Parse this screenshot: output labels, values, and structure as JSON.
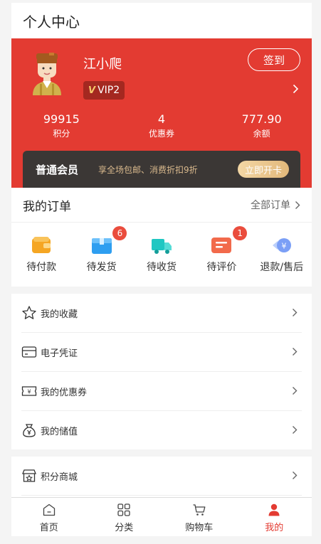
{
  "page_title": "个人中心",
  "profile": {
    "name": "江小爬",
    "vip_label": "VIP2",
    "signin_label": "签到"
  },
  "stats": [
    {
      "value": "99915",
      "label": "积分"
    },
    {
      "value": "4",
      "label": "优惠券"
    },
    {
      "value": "777.90",
      "label": "余额"
    }
  ],
  "membership": {
    "title": "普通会员",
    "desc": "享全场包邮、消费折扣9折",
    "button": "立即开卡"
  },
  "orders": {
    "title": "我的订单",
    "all_label": "全部订单",
    "items": [
      {
        "label": "待付款",
        "icon": "wallet-icon",
        "badge": ""
      },
      {
        "label": "待发货",
        "icon": "box-icon",
        "badge": "6"
      },
      {
        "label": "待收货",
        "icon": "truck-icon",
        "badge": ""
      },
      {
        "label": "待评价",
        "icon": "comment-icon",
        "badge": "1"
      },
      {
        "label": "退款/售后",
        "icon": "refund-icon",
        "badge": ""
      }
    ]
  },
  "menu": [
    {
      "label": "我的收藏",
      "icon": "star-icon"
    },
    {
      "label": "电子凭证",
      "icon": "card-icon"
    },
    {
      "label": "我的优惠券",
      "icon": "coupon-icon"
    },
    {
      "label": "我的储值",
      "icon": "moneybag-icon"
    }
  ],
  "menu2": [
    {
      "label": "积分商城",
      "icon": "store-icon"
    }
  ],
  "tabs": [
    {
      "label": "首页",
      "icon": "home-icon"
    },
    {
      "label": "分类",
      "icon": "grid-icon"
    },
    {
      "label": "购物车",
      "icon": "cart-icon"
    },
    {
      "label": "我的",
      "icon": "user-icon"
    }
  ],
  "colors": {
    "brand": "#e33b32",
    "member_bg": "#3b3735",
    "gold": "#d9b98d"
  }
}
